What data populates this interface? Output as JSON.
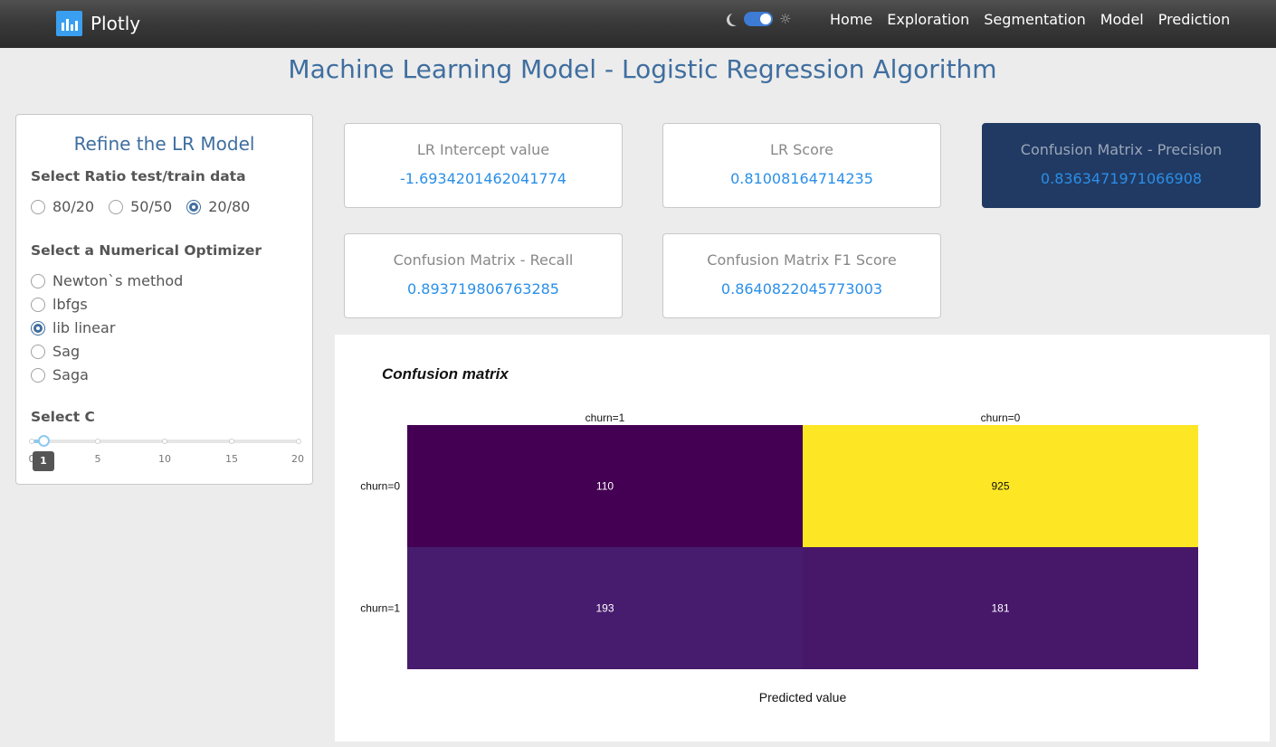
{
  "navbar": {
    "brand": "Plotly",
    "links": [
      "Home",
      "Exploration",
      "Segmentation",
      "Model",
      "Prediction"
    ]
  },
  "page_title": "Machine Learning Model - Logistic Regression Algorithm",
  "sidebar": {
    "title": "Refine the LR Model",
    "ratio": {
      "label": "Select Ratio test/train data",
      "options": [
        "80/20",
        "50/50",
        "20/80"
      ],
      "selected": "20/80"
    },
    "optimizer": {
      "label": "Select a Numerical Optimizer",
      "options": [
        "Newton`s method",
        "lbfgs",
        "lib linear",
        "Sag",
        "Saga"
      ],
      "selected": "lib linear"
    },
    "c_slider": {
      "label": "Select C",
      "min": 0,
      "max": 20,
      "ticks": [
        "0",
        "5",
        "10",
        "15",
        "20"
      ],
      "value": "1"
    }
  },
  "metrics": [
    {
      "label": "LR Intercept value",
      "value": "-1.6934201462041774"
    },
    {
      "label": "LR Score",
      "value": "0.81008164714235"
    },
    {
      "label": "Confusion Matrix - Precision",
      "value": "0.8363471971066908"
    },
    {
      "label": "Confusion Matrix - Recall",
      "value": "0.893719806763285"
    },
    {
      "label": "Confusion Matrix F1 Score",
      "value": "0.8640822045773003"
    }
  ],
  "colors": {
    "accent": "#3f6e9f",
    "metric_value": "#2a8fe8",
    "highlight_card": "#213a63"
  },
  "chart_data": {
    "type": "heatmap",
    "title": "Confusion matrix",
    "x_categories": [
      "churn=1",
      "churn=0"
    ],
    "y_categories": [
      "churn=0",
      "churn=1"
    ],
    "values": [
      [
        110,
        925
      ],
      [
        193,
        181
      ]
    ],
    "xlabel": "Predicted value",
    "ylabel": "",
    "colorscale": "viridis"
  }
}
